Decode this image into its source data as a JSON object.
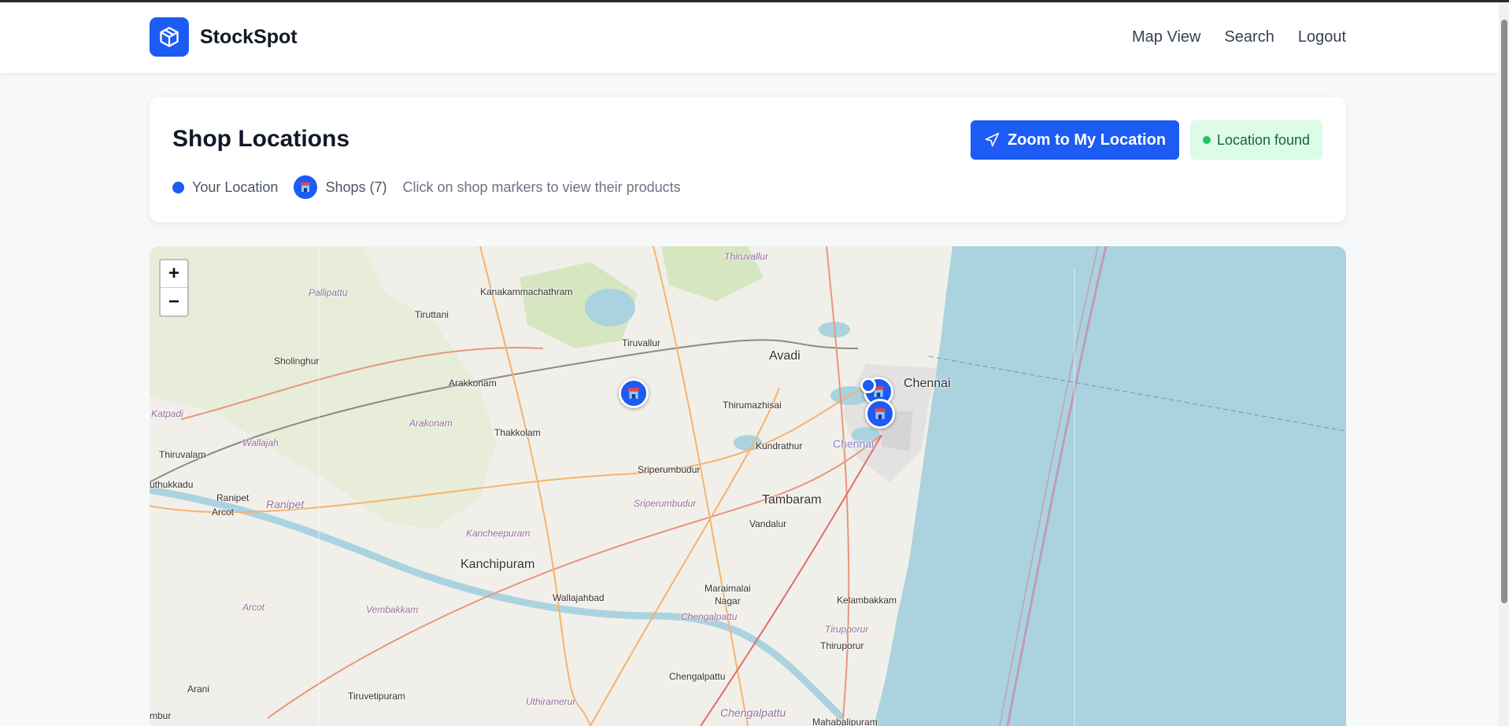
{
  "brand": {
    "name": "StockSpot",
    "logo_icon": "package-icon",
    "accent": "#1d5bf5"
  },
  "nav": {
    "items": [
      {
        "label": "Map View"
      },
      {
        "label": "Search"
      },
      {
        "label": "Logout"
      }
    ]
  },
  "header_card": {
    "title": "Shop Locations",
    "legend": {
      "your_location": "Your Location",
      "shops": "Shops (7)",
      "hint": "Click on shop markers to view their products"
    },
    "zoom_button": "Zoom to My Location",
    "status": "Location found",
    "status_color": "#22c55e"
  },
  "map": {
    "zoom_in": "+",
    "zoom_out": "−",
    "sea_color": "#aad3df",
    "places": [
      "Thiruvallur",
      "Pallipattu",
      "Kanakammachathram",
      "Tiruttani",
      "Tiruvallur",
      "Avadi",
      "Chennai",
      "Sholinghur",
      "Arakkonam",
      "Arakonam",
      "Thirumazhisai",
      "Katpadi",
      "Wallajah",
      "Thakkolam",
      "Chennai",
      "Kundrathur",
      "Thiruvalam",
      "Sriperumbudur",
      "uthukkadu",
      "Ranipet",
      "Ranipet",
      "Sriperumbudur",
      "Tambaram",
      "Arcot",
      "Kancheepuram",
      "Vandalur",
      "Kanchipuram",
      "Maraimalai",
      "Nagar",
      "Wallajahbad",
      "Kelambakkam",
      "Vembakkam",
      "Arcot",
      "Chengalpattu",
      "Tirupporur",
      "Thiruporur",
      "Chengalpattu",
      "Arani",
      "Tiruvetipuram",
      "Uthiramerur",
      "Chengalpattu",
      "Mahabalipuram",
      "mbur"
    ]
  }
}
